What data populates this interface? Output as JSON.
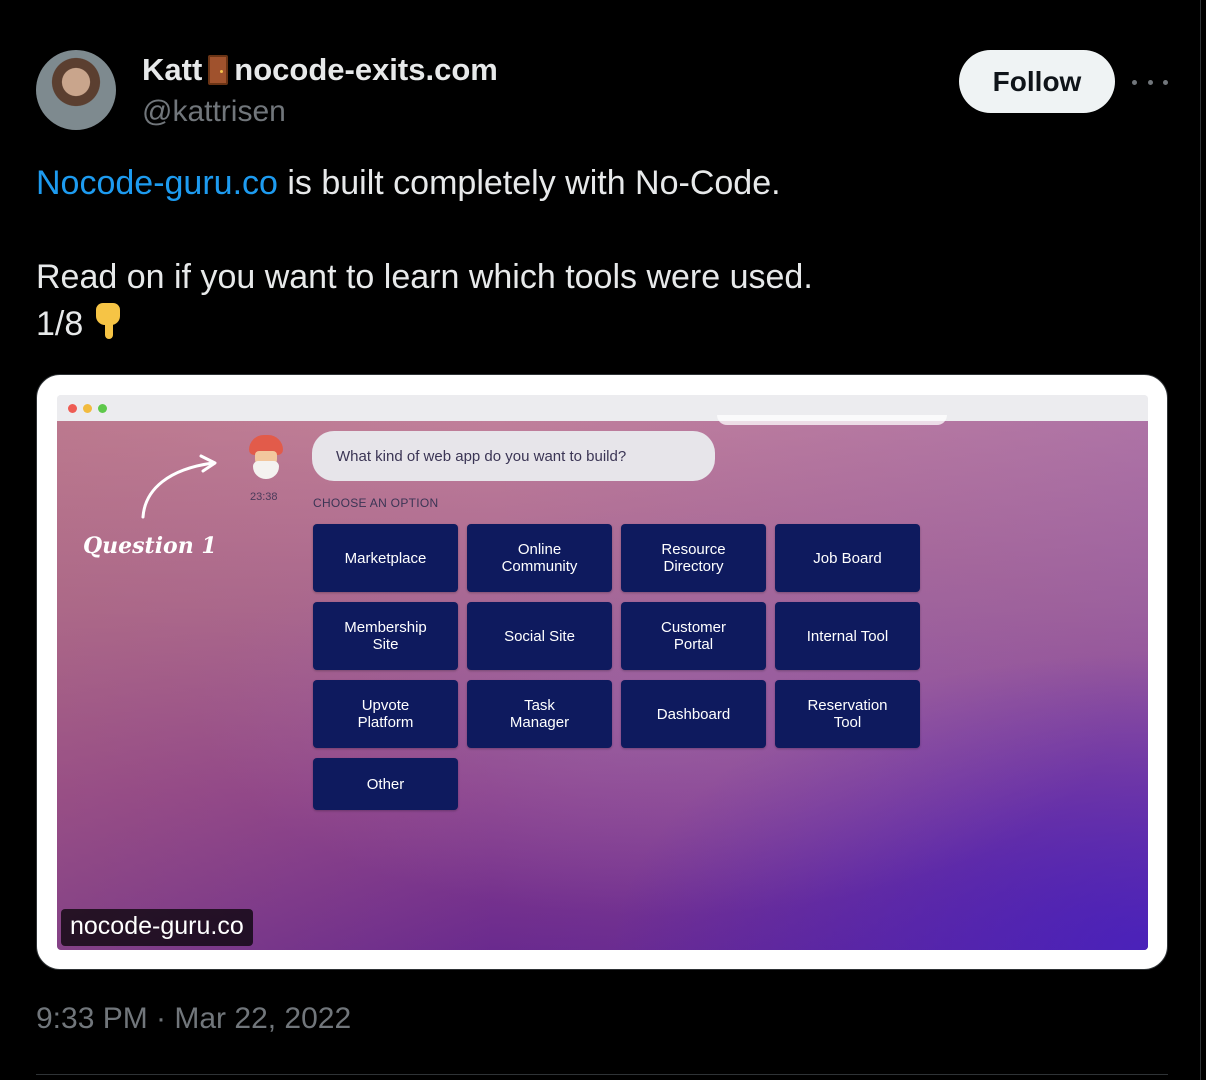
{
  "author": {
    "name": "Katt",
    "name_suffix": "nocode-exits.com",
    "handle": "@kattrisen"
  },
  "follow_label": "Follow",
  "tweet": {
    "link_text": "Nocode-guru.co",
    "line1_rest": " is built completely with No-Code.",
    "line2": "Read on if you want to learn which tools were used.",
    "line3": "1/8"
  },
  "media": {
    "chat": {
      "question": "What kind of web app do you want to build?",
      "time": "23:38",
      "choose_label": "CHOOSE AN OPTION",
      "annotation": "Question 1"
    },
    "options": [
      "Marketplace",
      "Online\nCommunity",
      "Resource\nDirectory",
      "Job Board",
      "Membership\nSite",
      "Social Site",
      "Customer\nPortal",
      "Internal Tool",
      "Upvote\nPlatform",
      "Task\nManager",
      "Dashboard",
      "Reservation\nTool",
      "Other"
    ],
    "caption": "nocode-guru.co"
  },
  "timestamp": "9:33 PM · Mar 22, 2022",
  "icons": {
    "door": "door-icon",
    "pointing_down": "backhand-index-pointing-down-icon",
    "more": "more-icon"
  },
  "colors": {
    "link": "#1d9bf0",
    "option_bg": "#0e1a5e",
    "follow_bg": "#eff3f4"
  }
}
